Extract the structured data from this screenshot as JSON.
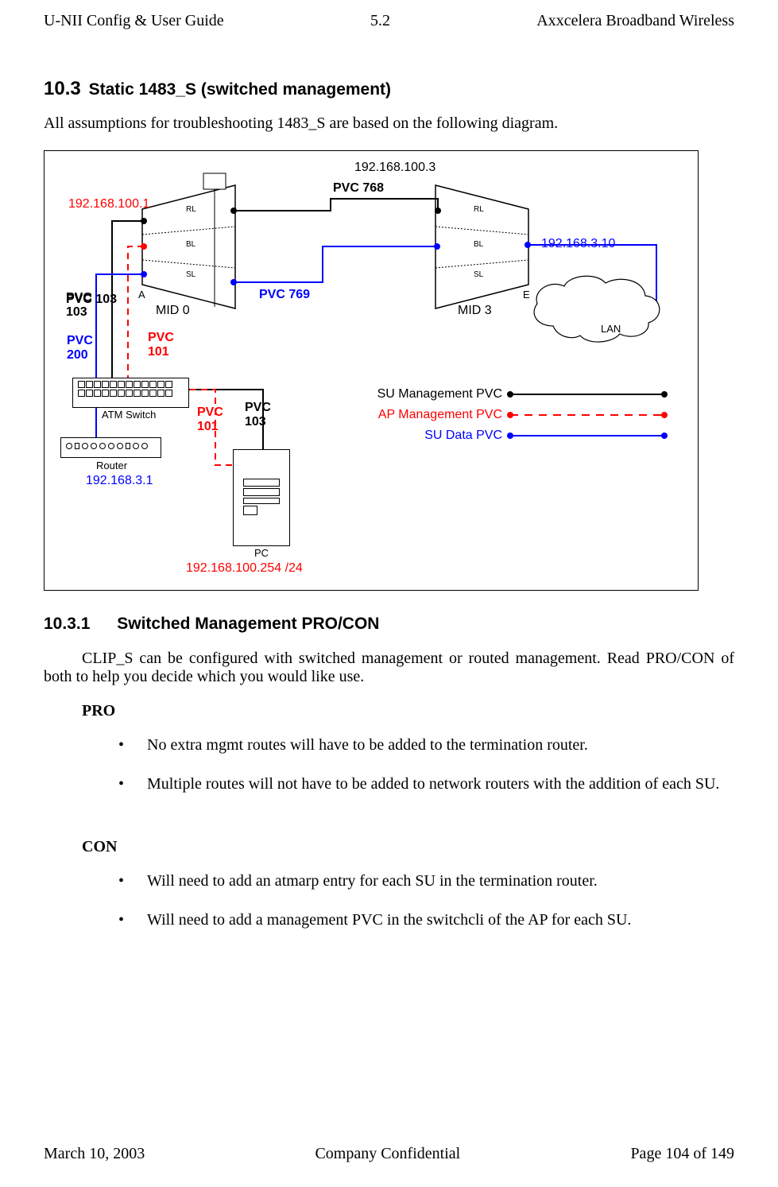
{
  "header": {
    "left": "U-NII Config & User Guide",
    "center": "5.2",
    "right": "Axxcelera Broadband Wireless"
  },
  "section": {
    "number": "10.3",
    "title": "Static 1483_S (switched management)",
    "intro": "All assumptions for troubleshooting 1483_S are based on the following diagram."
  },
  "subsection": {
    "number": "10.3.1",
    "title": "Switched Management PRO/CON",
    "intro": "CLIP_S can be configured with switched management or routed management. Read PRO/CON of both to help you decide which you would like use.",
    "pro_title": "PRO",
    "pro_items": [
      "No extra mgmt routes will have to be added to the termination router.",
      "Multiple routes will not have to be added to network routers with the addition of each SU."
    ],
    "con_title": "CON",
    "con_items": [
      "Will need to add an atmarp entry for each SU in the termination router.",
      "Will need to add a management PVC in the switchcli of the AP for each SU."
    ]
  },
  "figure": {
    "ip_top": "192.168.100.3",
    "ip_left": "192.168.100.1",
    "ip_lan": "192.168.3.10",
    "ip_router": "192.168.3.1",
    "ip_pc": "192.168.100.254 /24",
    "pvc768": "PVC 768",
    "pvc769": "PVC 769",
    "pvc101a": "PVC 101",
    "pvc101b": "PVC 101",
    "pvc103a": "PVC 103",
    "pvc103b": "PVC 103",
    "pvc200": "PVC 200",
    "mid0": "MID 0",
    "mid3": "MID 3",
    "labelA": "A",
    "labelE": "E",
    "rl": "RL",
    "bl": "BL",
    "sl": "SL",
    "atm": "ATM Switch",
    "router": "Router",
    "pc": "PC",
    "lan": "LAN",
    "legend_su_mgmt": "SU Management PVC",
    "legend_ap_mgmt": "AP Management PVC",
    "legend_su_data": "SU Data PVC"
  },
  "footer": {
    "left": "March 10, 2003",
    "center": "Company Confidential",
    "right": "Page 104 of 149"
  }
}
